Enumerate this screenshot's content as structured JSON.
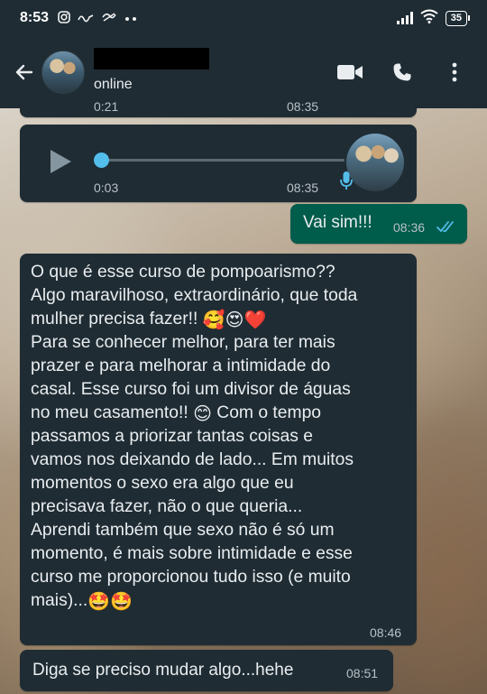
{
  "status_bar": {
    "time": "8:53",
    "notification_icons": [
      "instagram-icon",
      "app-badge-icon",
      "sync-icon",
      "more-dots"
    ],
    "battery": "35"
  },
  "header": {
    "contact_status": "online",
    "actions": [
      "video-call-icon",
      "voice-call-icon",
      "overflow-menu-icon"
    ]
  },
  "messages": [
    {
      "type": "voice",
      "direction": "incoming",
      "duration": "0:21",
      "time": "08:35",
      "partial": true
    },
    {
      "type": "voice",
      "direction": "incoming",
      "duration": "0:03",
      "time": "08:35"
    },
    {
      "type": "text",
      "direction": "outgoing",
      "text": "Vai sim!!!",
      "time": "08:36",
      "status": "read"
    },
    {
      "type": "text",
      "direction": "incoming",
      "time": "08:46",
      "lines": [
        "O que é esse curso de pompoarismo??",
        "Algo maravilhoso, extraordinário, que toda",
        "mulher precisa fazer!! ",
        "Para se conhecer melhor, para ter mais",
        "prazer e para melhorar a intimidade do",
        "casal. Esse curso foi um divisor de águas",
        "no meu casamento!! ",
        "Com o tempo",
        "passamos a priorizar tantas coisas e",
        "vamos nos deixando de lado... Em muitos",
        "momentos o sexo era algo que eu",
        "precisava fazer, não o que queria...",
        "Aprendi também que sexo não é só um",
        "momento, é mais sobre intimidade e esse",
        "curso me proporcionou tudo isso (e muito",
        "mais)..."
      ],
      "emoji": {
        "line3": "🥰😍❤️",
        "line7": "😊",
        "line16": "🤩🤩"
      }
    },
    {
      "type": "text",
      "direction": "incoming",
      "text": "Diga se preciso mudar algo...hehe",
      "time": "08:51"
    }
  ],
  "colors": {
    "bar_bg": "#1f2c34",
    "incoming_bubble": "#1f2c34",
    "outgoing_bubble": "#005c4b",
    "voice_knob": "#53bdeb",
    "read_ticks": "#53bdeb"
  }
}
